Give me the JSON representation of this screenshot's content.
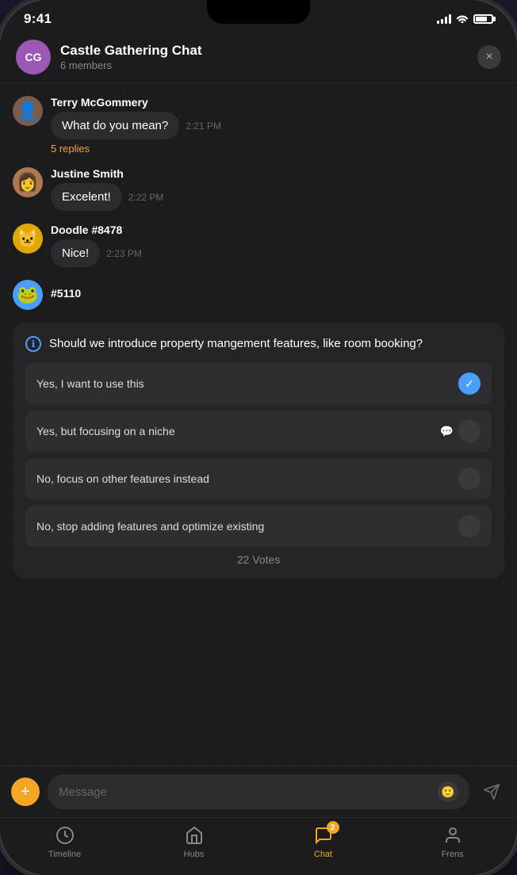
{
  "status_bar": {
    "time": "9:41",
    "signal": "signal",
    "wifi": "wifi",
    "battery": "battery"
  },
  "header": {
    "avatar_initials": "CG",
    "title": "Castle Gathering Chat",
    "subtitle": "6 members",
    "close_label": "×"
  },
  "messages": [
    {
      "id": "msg1",
      "username": "Terry McGommery",
      "avatar": "👤",
      "avatar_bg": "#7a5c4a",
      "bubble": "What do you mean?",
      "time": "2:21 PM",
      "replies": "5 replies"
    },
    {
      "id": "msg2",
      "username": "Justine Smith",
      "avatar": "👩",
      "avatar_bg": "#c4956a",
      "bubble": "Excelent!",
      "time": "2:22 PM",
      "replies": null
    },
    {
      "id": "msg3",
      "username": "Doodle #8478",
      "avatar": "🐱",
      "avatar_bg": "#f0c040",
      "bubble": "Nice!",
      "time": "2:23 PM",
      "replies": null
    }
  ],
  "partial_username": "#5110",
  "poll": {
    "info_icon": "ℹ",
    "question": "Should we introduce property mangement features, like room booking?",
    "options": [
      {
        "text": "Yes, I want to use this",
        "type": "checked",
        "has_comment": false
      },
      {
        "text": "Yes, but focusing on a niche",
        "type": "radio",
        "has_comment": true
      },
      {
        "text": "No, focus on other features instead",
        "type": "radio",
        "has_comment": false
      },
      {
        "text": "No, stop adding features and optimize existing",
        "type": "radio",
        "has_comment": false
      }
    ],
    "votes_label": "22 Votes"
  },
  "input": {
    "placeholder": "Message",
    "add_icon": "+",
    "emoji_icon": "🙂",
    "send_icon": "➤"
  },
  "nav": {
    "items": [
      {
        "id": "timeline",
        "label": "Timeline",
        "icon": "timeline",
        "active": false,
        "badge": null
      },
      {
        "id": "hubs",
        "label": "Hubs",
        "icon": "hubs",
        "active": false,
        "badge": null
      },
      {
        "id": "chat",
        "label": "Chat",
        "icon": "chat",
        "active": true,
        "badge": "2"
      },
      {
        "id": "frens",
        "label": "Frens",
        "icon": "frens",
        "active": false,
        "badge": null
      }
    ]
  }
}
